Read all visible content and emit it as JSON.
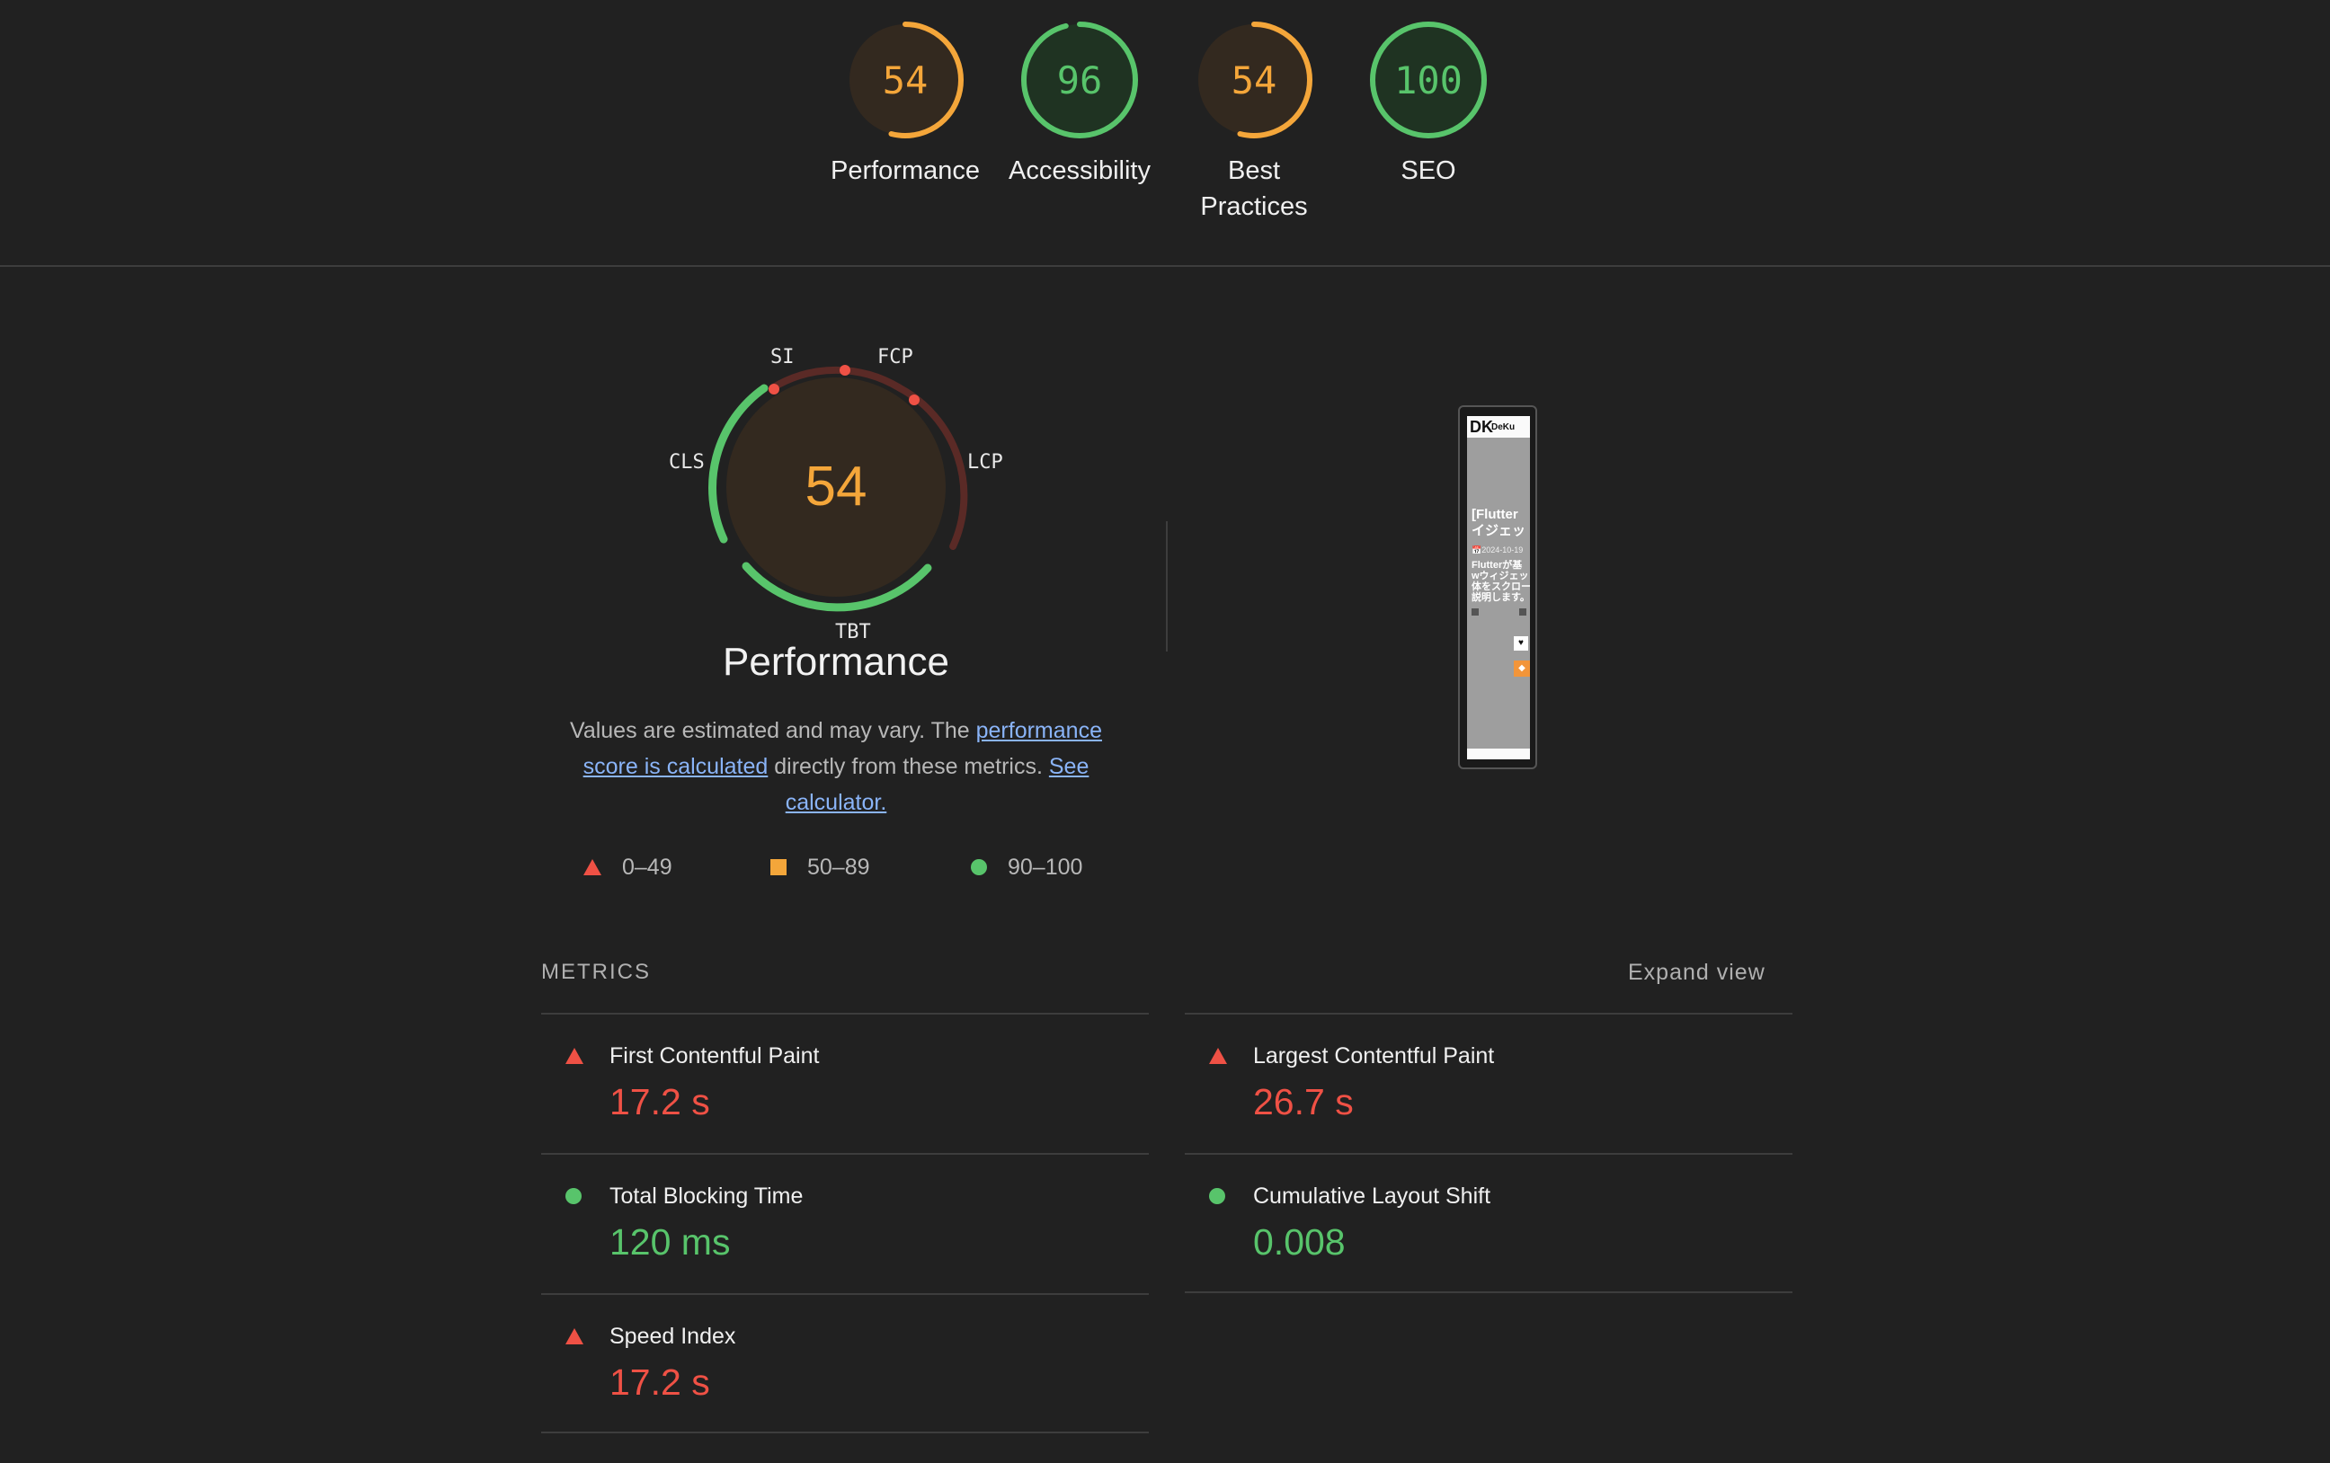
{
  "summary": [
    {
      "score": "54",
      "label": "Performance",
      "score_value": 54,
      "color": "#f4a63a"
    },
    {
      "score": "96",
      "label": "Accessibility",
      "score_value": 96,
      "color": "#58c46b"
    },
    {
      "score": "54",
      "label": "Best Practices",
      "score_value": 54,
      "color": "#f4a63a"
    },
    {
      "score": "100",
      "label": "SEO",
      "score_value": 100,
      "color": "#58c46b"
    }
  ],
  "performance": {
    "score": "54",
    "title": "Performance",
    "gauge_labels": {
      "si": "SI",
      "fcp": "FCP",
      "lcp": "LCP",
      "tbt": "TBT",
      "cls": "CLS"
    },
    "description_prefix": "Values are estimated and may vary. The ",
    "link_calc": "performance score is calculated",
    "description_mid": " directly from these metrics. ",
    "link_calculator": "See calculator.",
    "legend": {
      "fail": "0–49",
      "average": "50–89",
      "pass": "90–100"
    }
  },
  "screenshot": {
    "logo": "DK",
    "brand": "DeKu",
    "title": "[Flutter\nイジェッ",
    "date": "📅2024-10-19",
    "body": "Flutterが基\nwウィジェッ\n体をスクロー\n説明します。"
  },
  "metrics": {
    "heading": "METRICS",
    "expand": "Expand view",
    "fcp": {
      "name": "First Contentful Paint",
      "value": "17.2 s"
    },
    "lcp": {
      "name": "Largest Contentful Paint",
      "value": "26.7 s"
    },
    "tbt": {
      "name": "Total Blocking Time",
      "value": "120 ms"
    },
    "cls": {
      "name": "Cumulative Layout Shift",
      "value": "0.008"
    },
    "si": {
      "name": "Speed Index",
      "value": "17.2 s"
    }
  },
  "colors": {
    "fail": "#ef5145",
    "average": "#f4a63a",
    "pass": "#58c46b",
    "link": "#8ab4f8"
  }
}
